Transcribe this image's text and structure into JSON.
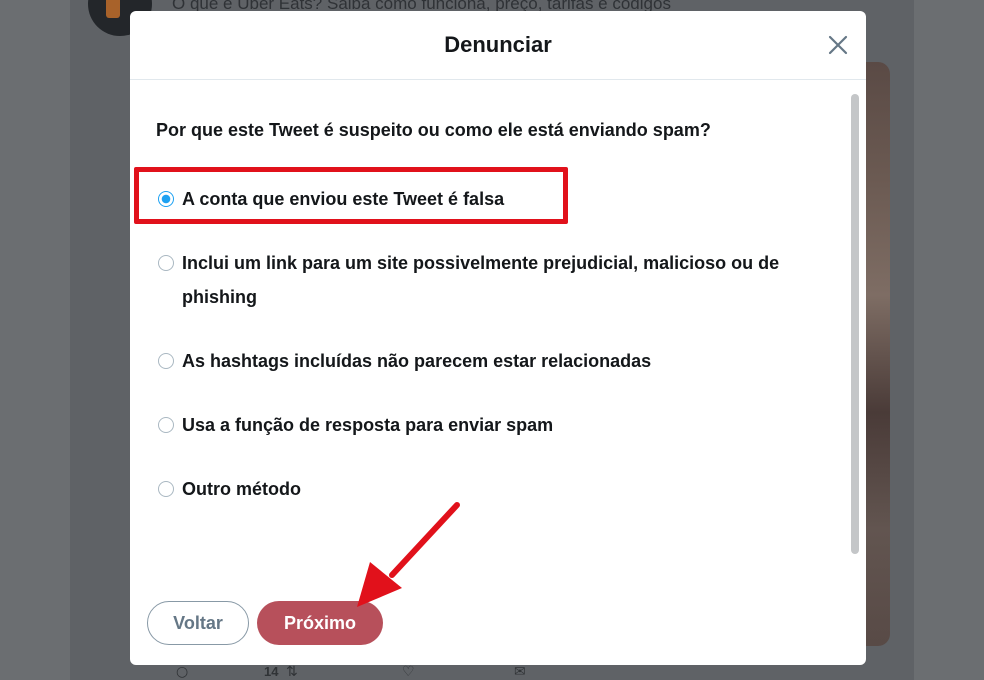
{
  "background": {
    "headline": "O que é Uber Eats? Saiba como funciona, preço, tarifas e códigos",
    "like_count": "14"
  },
  "modal": {
    "title": "Denunciar",
    "close_icon": "close-icon",
    "question": "Por que este Tweet é suspeito ou como ele está enviando spam?",
    "options": [
      {
        "label": "A conta que enviou este Tweet é falsa",
        "selected": true
      },
      {
        "label": "Inclui um link para um site possivelmente prejudicial, malicioso ou de phishing",
        "selected": false
      },
      {
        "label": "As hashtags incluídas não parecem estar relacionadas",
        "selected": false
      },
      {
        "label": "Usa a função de resposta para enviar spam",
        "selected": false
      },
      {
        "label": "Outro método",
        "selected": false
      }
    ],
    "back_label": "Voltar",
    "next_label": "Próximo"
  },
  "colors": {
    "accent": "#1da1f2",
    "next_button": "#b7505b",
    "highlight": "#e1111b",
    "arrow": "#e1111b"
  }
}
